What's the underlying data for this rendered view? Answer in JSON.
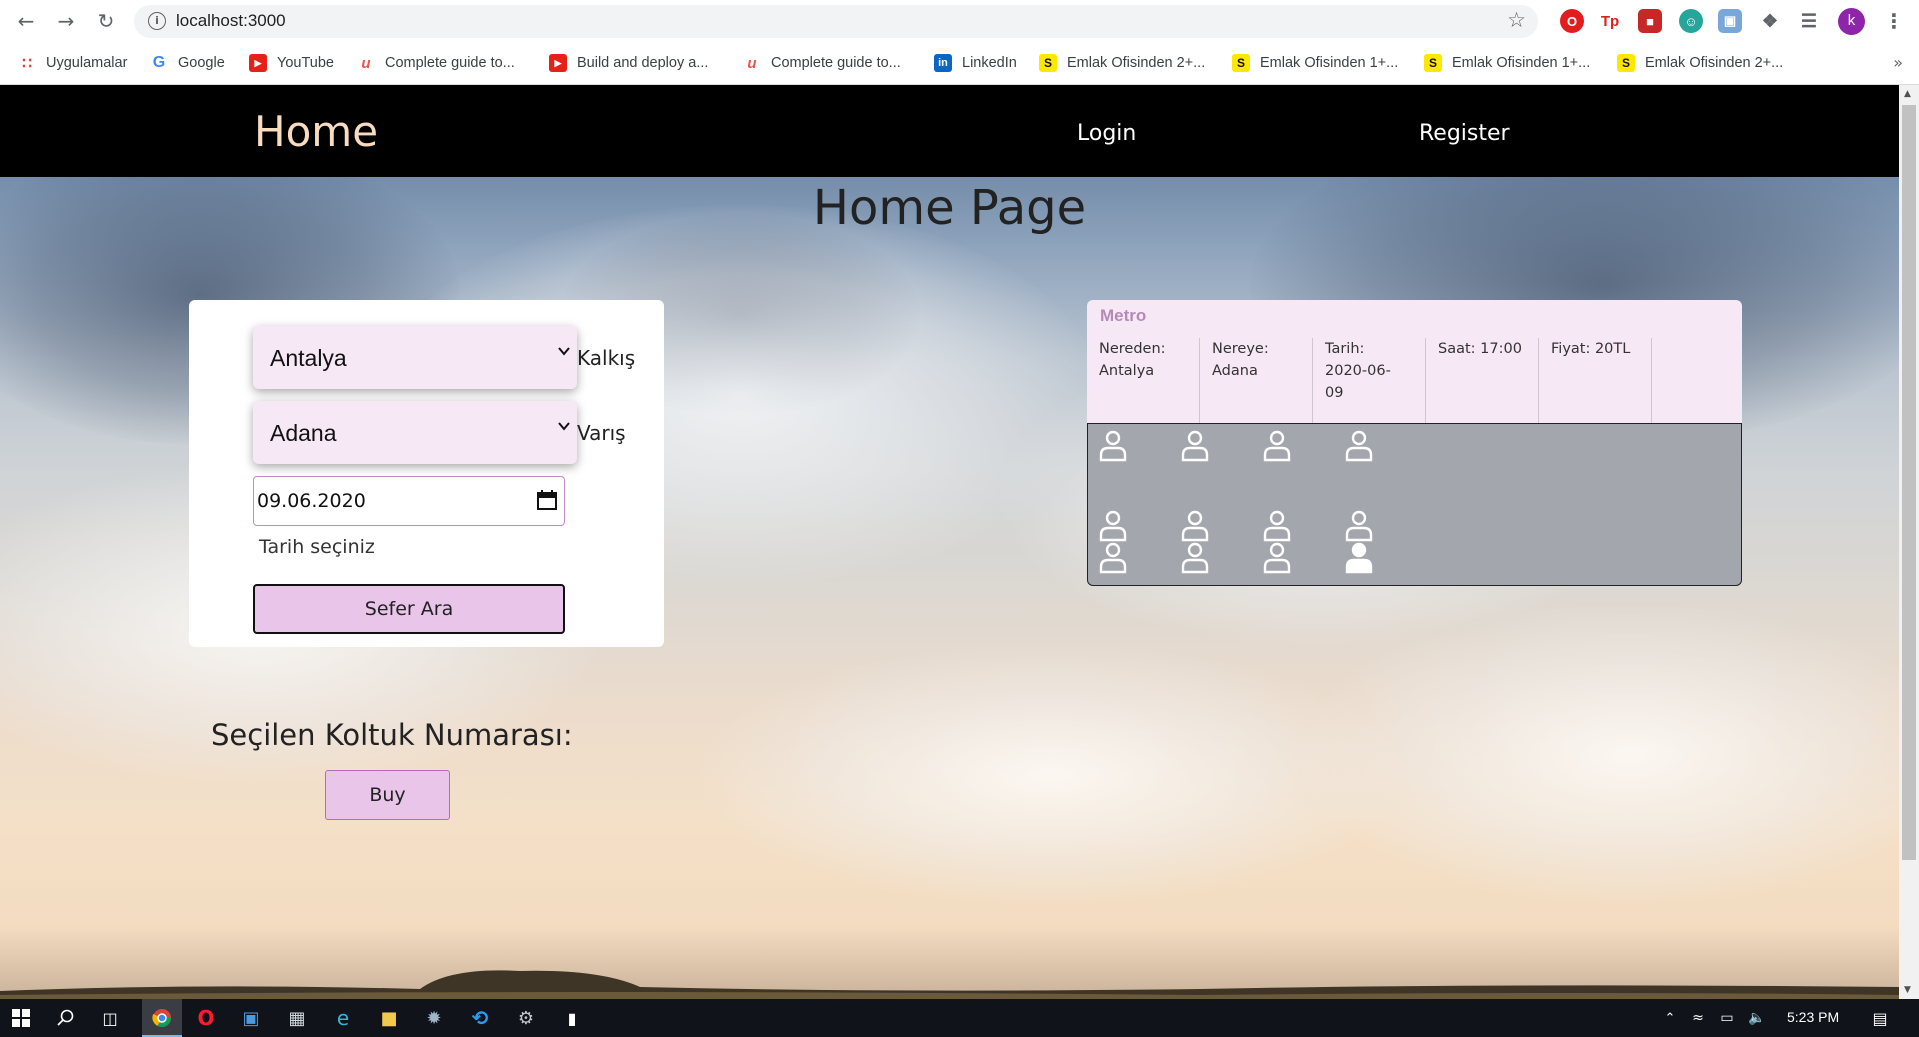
{
  "browser": {
    "url": "localhost:3000",
    "bookmarks": [
      {
        "label": "Uygulamalar",
        "icon": "apps-grid-icon"
      },
      {
        "label": "Google",
        "icon": "google-icon"
      },
      {
        "label": "YouTube",
        "icon": "youtube-icon"
      },
      {
        "label": "Complete guide to...",
        "icon": "udemy-icon"
      },
      {
        "label": "Build and deploy a...",
        "icon": "youtube-icon"
      },
      {
        "label": "Complete guide to...",
        "icon": "udemy-icon"
      },
      {
        "label": "LinkedIn",
        "icon": "linkedin-icon"
      },
      {
        "label": "Emlak Ofisinden 2+...",
        "icon": "sahibinden-icon"
      },
      {
        "label": "Emlak Ofisinden 1+...",
        "icon": "sahibinden-icon"
      },
      {
        "label": "Emlak Ofisinden 1+...",
        "icon": "sahibinden-icon"
      },
      {
        "label": "Emlak Ofisinden 2+...",
        "icon": "sahibinden-icon"
      }
    ],
    "profile_initial": "k"
  },
  "navbar": {
    "home": "Home",
    "login": "Login",
    "register": "Register"
  },
  "page": {
    "title": "Home Page"
  },
  "search": {
    "from_value": "Antalya",
    "from_label": "Kalkış",
    "to_value": "Adana",
    "to_label": "Varış",
    "date_value": "09.06.2020",
    "date_hint": "Tarih seçiniz",
    "search_button": "Sefer Ara"
  },
  "selection": {
    "seat_label": "Seçilen Koltuk Numarası:",
    "buy_button": "Buy"
  },
  "trip": {
    "name": "Metro",
    "from_line1": "Nereden:",
    "from_line2": "Antalya",
    "to_line1": "Nereye:",
    "to_line2": "Adana",
    "date_line1": "Tarih:",
    "date_line2": "2020-06-",
    "date_line3": "09",
    "time": "Saat: 17:00",
    "price": "Fiyat: 20TL"
  },
  "seats": {
    "rows": [
      [
        "empty",
        "empty",
        "empty",
        "empty"
      ],
      [
        "empty",
        "empty",
        "empty",
        "empty"
      ],
      [
        "empty",
        "empty",
        "empty",
        "occupied"
      ]
    ]
  },
  "taskbar": {
    "time": "5:23 PM"
  }
}
